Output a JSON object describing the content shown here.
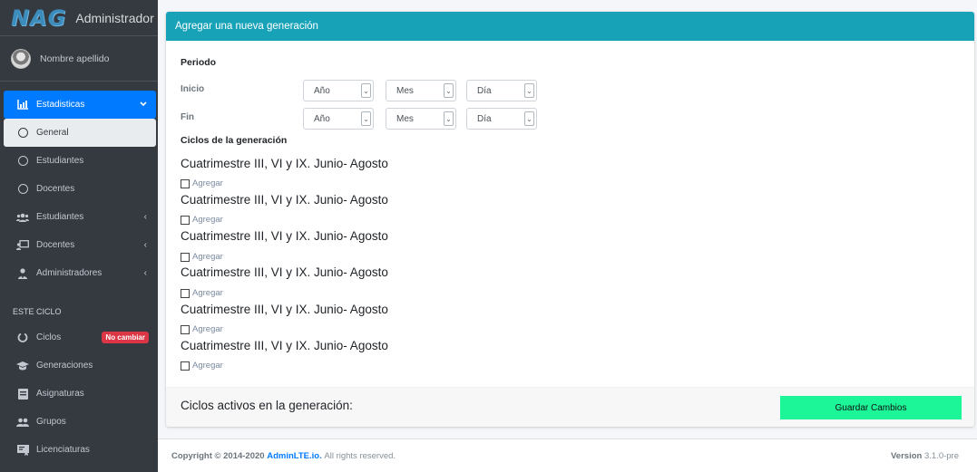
{
  "brand": {
    "logo": "NAG",
    "title": "Administrador"
  },
  "user": {
    "name": "Nombre apellido"
  },
  "sidebar": {
    "items": [
      {
        "label": "Estadisticas",
        "icon": "chart-icon",
        "state": "active",
        "chevron": "⌄"
      },
      {
        "label": "General",
        "icon": "circle-icon",
        "state": "sub-active"
      },
      {
        "label": "Estudiantes",
        "icon": "circle-icon"
      },
      {
        "label": "Docentes",
        "icon": "circle-icon"
      },
      {
        "label": "Estudiantes",
        "icon": "users-icon",
        "chevron": "‹"
      },
      {
        "label": "Docentes",
        "icon": "chalkboard-icon",
        "chevron": "‹"
      },
      {
        "label": "Administradores",
        "icon": "user-tie-icon",
        "chevron": "‹"
      }
    ],
    "header": "ESTE CICLO",
    "cycle_items": [
      {
        "label": "Ciclos",
        "icon": "circle-notch-icon",
        "badge": "No cambiar"
      },
      {
        "label": "Generaciones",
        "icon": "graduation-cap-icon"
      },
      {
        "label": "Asignaturas",
        "icon": "book-icon"
      },
      {
        "label": "Grupos",
        "icon": "users-icon"
      },
      {
        "label": "Licenciaturas",
        "icon": "diploma-icon"
      }
    ]
  },
  "card": {
    "title": "Agregar una nueva generación",
    "periodo_label": "Periodo",
    "inicio_label": "Inicio",
    "fin_label": "Fin",
    "selects": {
      "year": "Año",
      "month": "Mes",
      "day": "Día"
    },
    "ciclos_label": "Ciclos de la generación",
    "ciclos": [
      {
        "name": "Cuatrimestre III, VI y IX. Junio- Agosto",
        "check_label": "Agregar"
      },
      {
        "name": "Cuatrimestre III, VI y IX. Junio- Agosto",
        "check_label": "Agregar"
      },
      {
        "name": "Cuatrimestre III, VI y IX. Junio- Agosto",
        "check_label": "Agregar"
      },
      {
        "name": "Cuatrimestre III, VI y IX. Junio- Agosto",
        "check_label": "Agregar"
      },
      {
        "name": "Cuatrimestre III, VI y IX. Junio- Agosto",
        "check_label": "Agregar"
      },
      {
        "name": "Cuatrimestre III, VI y IX. Junio- Agosto",
        "check_label": "Agregar"
      }
    ],
    "footer_label": "Ciclos activos en la generación:",
    "save_label": "Guardar Cambios"
  },
  "footer": {
    "copyright": "Copyright © 2014-2020",
    "link": "AdminLTE.io.",
    "rights": "All rights reserved.",
    "version_label": "Version",
    "version": "3.1.0-pre"
  },
  "colors": {
    "header": "#17a2b8",
    "active": "#007bff",
    "save": "#1cf598",
    "sidebar": "#343a40"
  }
}
